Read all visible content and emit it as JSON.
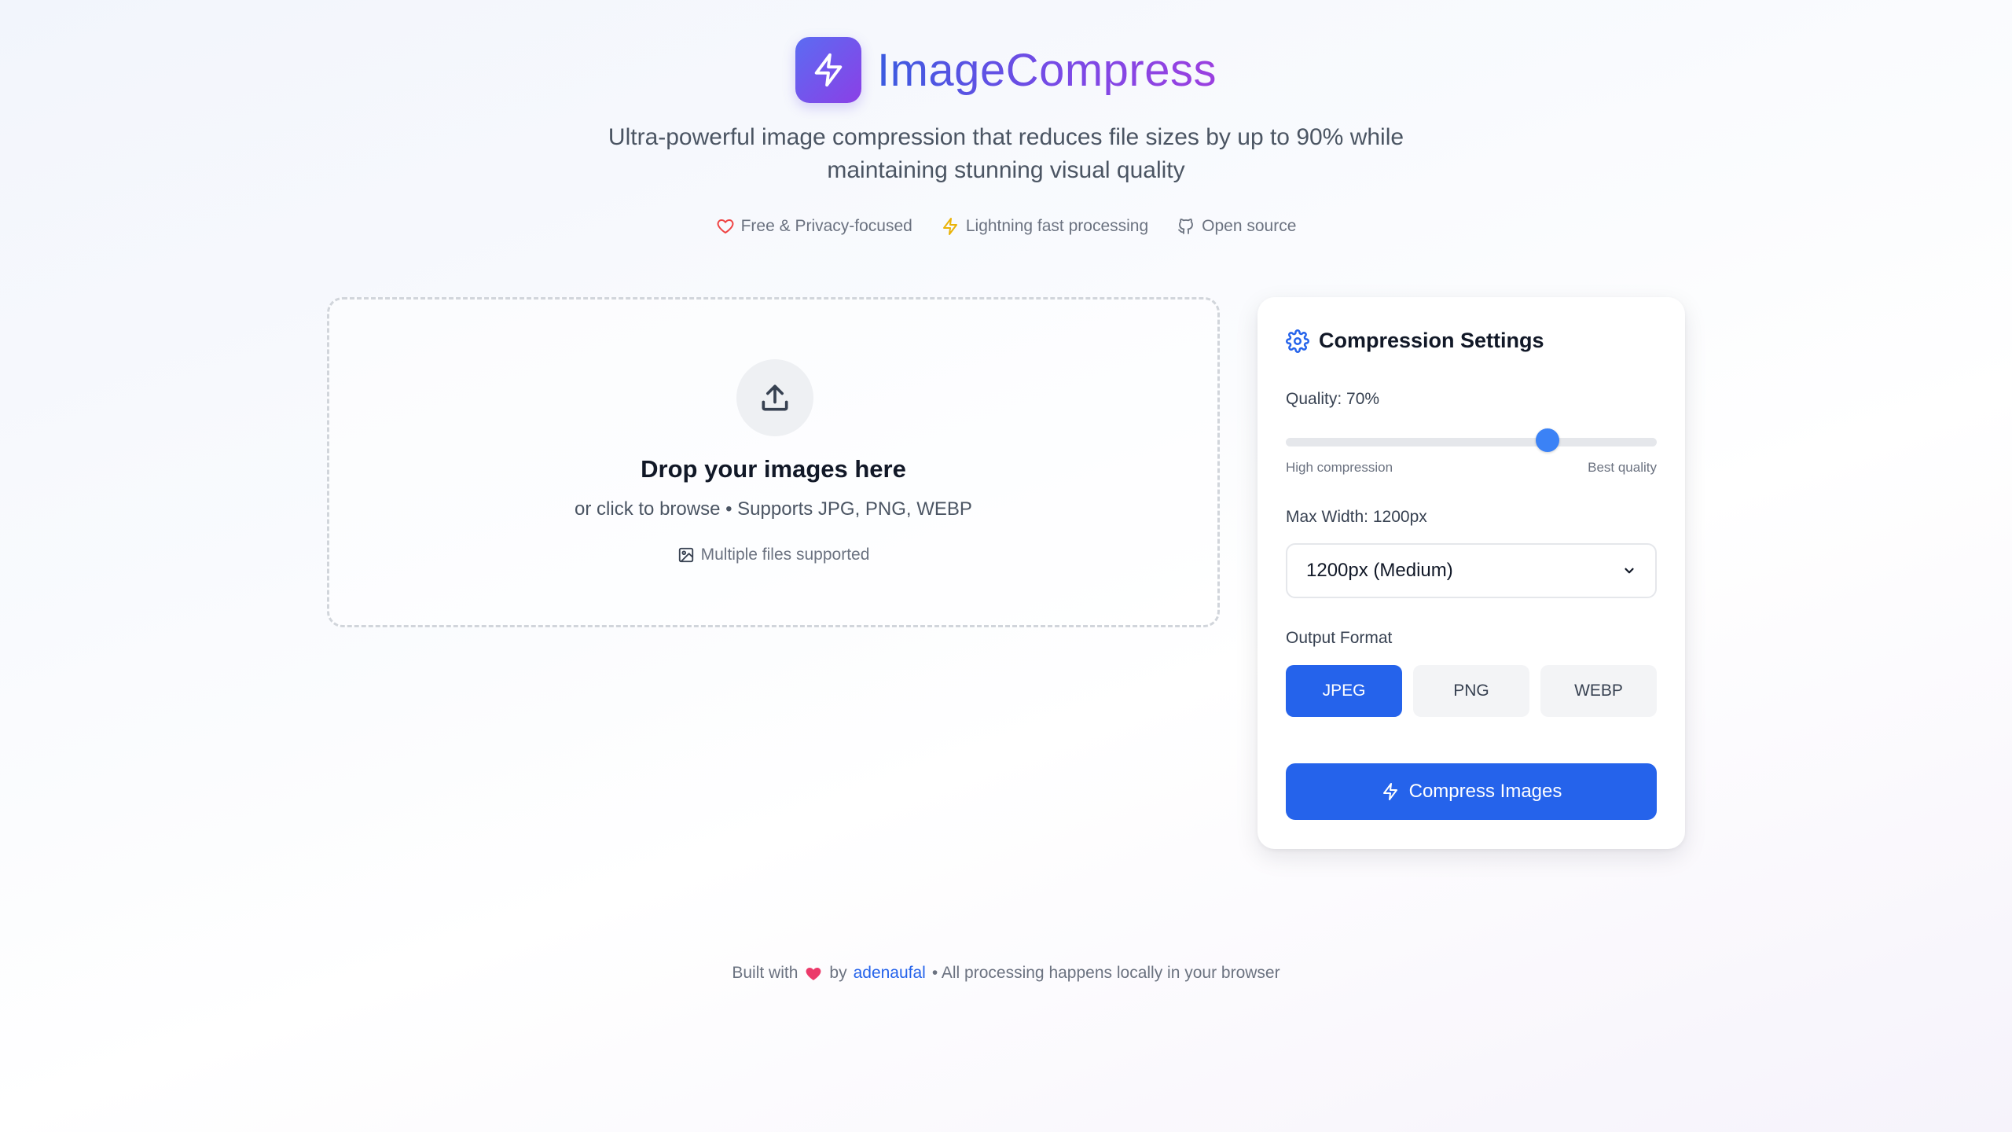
{
  "header": {
    "app_name": "ImageCompress",
    "logo_icon": "lightning-icon",
    "subtitle": "Ultra-powerful image compression that reduces file sizes by up to 90% while maintaining stunning visual quality",
    "features": [
      {
        "icon": "heart-icon",
        "label": "Free & Privacy-focused"
      },
      {
        "icon": "lightning-icon",
        "label": "Lightning fast processing"
      },
      {
        "icon": "github-icon",
        "label": "Open source"
      }
    ]
  },
  "dropzone": {
    "icon": "upload-icon",
    "title": "Drop your images here",
    "subtitle": "or click to browse • Supports JPG, PNG, WEBP",
    "multi_label": "Multiple files supported"
  },
  "settings": {
    "title": "Compression Settings",
    "quality_label": "Quality: 70%",
    "quality_value": 0.7,
    "slider_min_label": "High compression",
    "slider_max_label": "Best quality",
    "max_width_label": "Max Width: 1200px",
    "max_width_selected": "1200px (Medium)",
    "output_format_label": "Output Format",
    "formats": [
      "JPEG",
      "PNG",
      "WEBP"
    ],
    "selected_format": "JPEG",
    "compress_button": "Compress Images"
  },
  "footer": {
    "built_with": "Built with",
    "by": "by",
    "author": "adenaufal",
    "suffix": "• All processing happens locally in your browser"
  },
  "colors": {
    "accent": "#2563eb",
    "slider_thumb": "#3b82f6",
    "logo_gradient_start": "#5b6cf2",
    "logo_gradient_end": "#8b3fe6",
    "heart": "#ef4444",
    "lightning": "#eab308"
  }
}
